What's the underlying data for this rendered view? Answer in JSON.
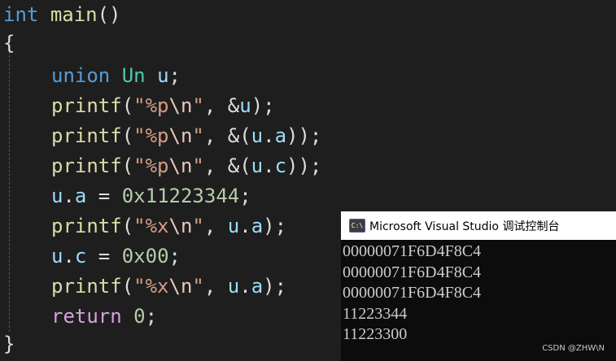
{
  "code": {
    "l1": {
      "kw": "int",
      "fn": "main",
      "rest": "()"
    },
    "l2": {
      "brace": "{"
    },
    "l3": {
      "kw": "union",
      "type": "Un",
      "var": "u",
      "rest": ";"
    },
    "l4": {
      "fn": "printf",
      "p1": "(",
      "str1": "\"%p",
      "esc": "\\n",
      "str2": "\"",
      "p2": ", &",
      "var": "u",
      "p3": ");"
    },
    "l5": {
      "fn": "printf",
      "p1": "(",
      "str1": "\"%p",
      "esc": "\\n",
      "str2": "\"",
      "p2": ", &(",
      "var1": "u",
      "dot": ".",
      "var2": "a",
      "p3": "));"
    },
    "l6": {
      "fn": "printf",
      "p1": "(",
      "str1": "\"%p",
      "esc": "\\n",
      "str2": "\"",
      "p2": ", &(",
      "var1": "u",
      "dot": ".",
      "var2": "c",
      "p3": "));"
    },
    "l7": {
      "var1": "u",
      "dot": ".",
      "var2": "a",
      "op": " = ",
      "num": "0x11223344",
      "rest": ";"
    },
    "l8": {
      "fn": "printf",
      "p1": "(",
      "str1": "\"%x",
      "esc": "\\n",
      "str2": "\"",
      "p2": ", ",
      "var1": "u",
      "dot": ".",
      "var2": "a",
      "p3": ");"
    },
    "l9": {
      "var1": "u",
      "dot": ".",
      "var2": "c",
      "op": " = ",
      "num": "0x00",
      "rest": ";"
    },
    "l10": {
      "fn": "printf",
      "p1": "(",
      "str1": "\"%x",
      "esc": "\\n",
      "str2": "\"",
      "p2": ", ",
      "var1": "u",
      "dot": ".",
      "var2": "a",
      "p3": ");"
    },
    "l11": {
      "kw": "return",
      "sp": " ",
      "num": "0",
      "rest": ";"
    },
    "l12": {
      "brace": "}"
    }
  },
  "console": {
    "icon": "C:\\",
    "title": "Microsoft Visual Studio 调试控制台",
    "lines": [
      "00000071F6D4F8C4",
      "00000071F6D4F8C4",
      "00000071F6D4F8C4",
      "11223344",
      "11223300"
    ]
  },
  "watermark": "CSDN @ZHW\\N",
  "colors": {
    "editor_bg": "#1e1e1e",
    "keyword": "#569cd6",
    "control_keyword": "#d8a0df",
    "type": "#4ec9b0",
    "function": "#dcdcaa",
    "string": "#d69d85",
    "variable": "#9cdcfe",
    "number": "#b5cea8",
    "console_bg": "#0c0c0c"
  }
}
